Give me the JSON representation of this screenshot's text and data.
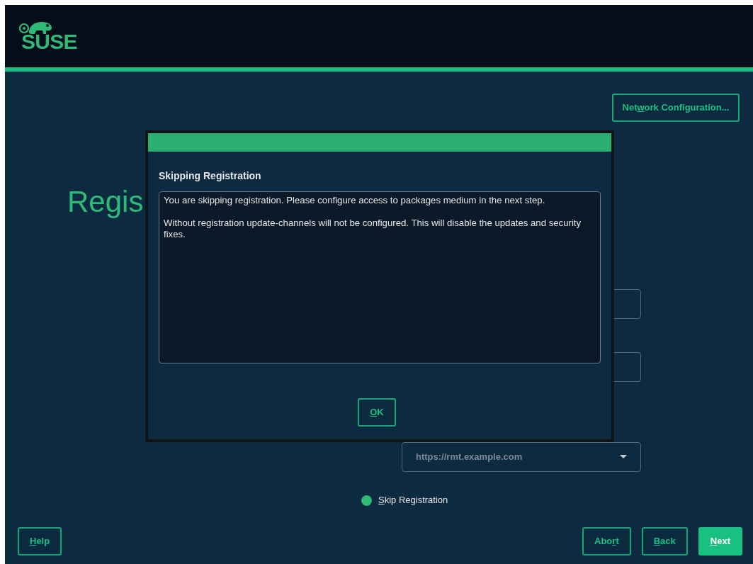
{
  "header": {
    "logo_text": "SUSE"
  },
  "network_button": {
    "before": "Net",
    "key": "w",
    "after": "ork Configuration..."
  },
  "heading": "Regis",
  "fields": [
    {
      "kind": "input"
    },
    {
      "kind": "input"
    },
    {
      "kind": "dropdown",
      "placeholder": "https://rmt.example.com"
    }
  ],
  "radio": {
    "key": "S",
    "after": "kip Registration",
    "selected": true
  },
  "dialog": {
    "title": "Skipping Registration",
    "paragraphs": [
      "You are skipping registration. Please configure access to packages medium in the next step.",
      "Without registration update-channels will not be configured. This will disable the updates and security fixes."
    ],
    "ok_button": {
      "key": "O",
      "after": "K"
    }
  },
  "footer": {
    "left": [
      {
        "key": "H",
        "after": "elp",
        "primary": false
      }
    ],
    "right": [
      {
        "before": "Abo",
        "key": "r",
        "after": "t",
        "primary": false
      },
      {
        "key": "B",
        "after": "ack",
        "primary": false
      },
      {
        "key": "N",
        "after": "ext",
        "primary": true
      }
    ]
  }
}
